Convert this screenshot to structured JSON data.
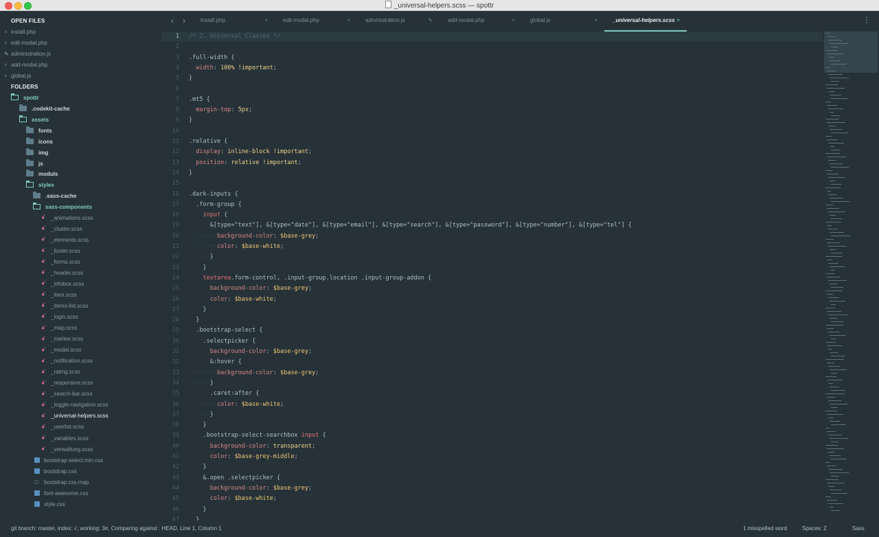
{
  "window": {
    "title": "_universal-helpers.scss — spottr"
  },
  "sidebar": {
    "open_files_header": "OPEN FILES",
    "open_files": [
      {
        "name": "install.php",
        "marker": "×"
      },
      {
        "name": "edit-modal.php",
        "marker": "×"
      },
      {
        "name": "administration.js",
        "marker": "✎"
      },
      {
        "name": "add-modal.php",
        "marker": "×"
      },
      {
        "name": "global.js",
        "marker": "×"
      }
    ],
    "folders_header": "FOLDERS",
    "tree": {
      "root": "spottr",
      "codekit": ".codekit-cache",
      "assets": "assets",
      "fonts": "fonts",
      "icons": "icons",
      "img": "img",
      "js": "js",
      "moduls": "moduls",
      "styles": "styles",
      "sass_cache": ".sass-cache",
      "sass_components": "sass-components",
      "scss_files": [
        "_animations.scss",
        "_cluster.scss",
        "_elements.scss",
        "_footer.scss",
        "_forms.scss",
        "_header.scss",
        "_infobox.scss",
        "_item.scss",
        "_items-list.scss",
        "_login.scss",
        "_map.scss",
        "_marker.scss",
        "_modal.scss",
        "_notification.scss",
        "_rating.scss",
        "_responsive.scss",
        "_search-bar.scss",
        "_toggle-navigation.scss",
        "_universal-helpers.scss",
        "_userlist.scss",
        "_variables.scss",
        "_verwaltung.scss"
      ],
      "css_files": [
        "bootstrap-select.min.css",
        "bootstrap.css",
        "bootstrap.css.map",
        "font-awesome.css",
        "style.css"
      ]
    }
  },
  "tabs": [
    {
      "label": "install.php",
      "close": "×"
    },
    {
      "label": "edit-modal.php",
      "close": "×"
    },
    {
      "label": "administration.js",
      "close": "✎"
    },
    {
      "label": "add-modal.php",
      "close": "×"
    },
    {
      "label": "global.js",
      "close": "×"
    },
    {
      "label": "_universal-helpers.scss",
      "close": "×",
      "active": true
    }
  ],
  "editor": {
    "lines": [
      [
        [
          "c-comment",
          "/* 2. Universal Classes */"
        ]
      ],
      [],
      [
        [
          "c-sel",
          ".full-width {"
        ]
      ],
      [
        [
          "g",
          "  "
        ],
        [
          "c-prop",
          "width"
        ],
        [
          "c-punct",
          ": "
        ],
        [
          "c-val",
          "100% !important"
        ],
        [
          "c-punct",
          ";"
        ]
      ],
      [
        [
          "c-sel",
          "}"
        ]
      ],
      [],
      [
        [
          "c-sel",
          ".mt5 {"
        ]
      ],
      [
        [
          "g",
          "  "
        ],
        [
          "c-prop",
          "margin-top"
        ],
        [
          "c-punct",
          ": "
        ],
        [
          "c-val",
          "5px"
        ],
        [
          "c-punct",
          ";"
        ]
      ],
      [
        [
          "c-sel",
          "}"
        ]
      ],
      [],
      [
        [
          "c-sel",
          ".relative {"
        ]
      ],
      [
        [
          "g",
          "  "
        ],
        [
          "c-prop",
          "display"
        ],
        [
          "c-punct",
          ": "
        ],
        [
          "c-val",
          "inline-block !important"
        ],
        [
          "c-punct",
          ";"
        ]
      ],
      [
        [
          "g",
          "  "
        ],
        [
          "c-prop",
          "position"
        ],
        [
          "c-punct",
          ": "
        ],
        [
          "c-val",
          "relative !important"
        ],
        [
          "c-punct",
          ";"
        ]
      ],
      [
        [
          "c-sel",
          "}"
        ]
      ],
      [],
      [
        [
          "c-sel",
          ".dark-inputs {"
        ]
      ],
      [
        [
          "g",
          "  "
        ],
        [
          "c-sel",
          ".form-group {"
        ]
      ],
      [
        [
          "g",
          "    "
        ],
        [
          "c-tag",
          "input"
        ],
        [
          "c-sel",
          " {"
        ]
      ],
      [
        [
          "g",
          "      "
        ],
        [
          "c-sel",
          "&[type=\"text\"], &[type=\"date\"], &[type=\"email\"], &[type=\"search\"], &[type=\"password\"], &[type=\"number\"], &[type=\"tel\"] {"
        ]
      ],
      [
        [
          "g",
          "········"
        ],
        [
          "c-prop",
          "background-color"
        ],
        [
          "c-punct",
          ": "
        ],
        [
          "c-var",
          "$base-grey"
        ],
        [
          "c-punct",
          ";"
        ]
      ],
      [
        [
          "g",
          "········"
        ],
        [
          "c-prop",
          "color"
        ],
        [
          "c-punct",
          ": "
        ],
        [
          "c-var",
          "$base-white"
        ],
        [
          "c-punct",
          ";"
        ]
      ],
      [
        [
          "g",
          "······"
        ],
        [
          "c-sel",
          "}"
        ]
      ],
      [
        [
          "g",
          "    "
        ],
        [
          "c-sel",
          "}"
        ]
      ],
      [
        [
          "g",
          "    "
        ],
        [
          "c-tag",
          "textarea"
        ],
        [
          "c-sel",
          ".form-control, .input-group.location .input-group-addon {"
        ]
      ],
      [
        [
          "g",
          "      "
        ],
        [
          "c-prop",
          "background-color"
        ],
        [
          "c-punct",
          ": "
        ],
        [
          "c-var",
          "$base-grey"
        ],
        [
          "c-punct",
          ";"
        ]
      ],
      [
        [
          "g",
          "      "
        ],
        [
          "c-prop",
          "color"
        ],
        [
          "c-punct",
          ": "
        ],
        [
          "c-var",
          "$base-white"
        ],
        [
          "c-punct",
          ";"
        ]
      ],
      [
        [
          "g",
          "    "
        ],
        [
          "c-sel",
          "}"
        ]
      ],
      [
        [
          "g",
          "  "
        ],
        [
          "c-sel",
          "}"
        ]
      ],
      [
        [
          "g",
          "  "
        ],
        [
          "c-sel",
          ".bootstrap-select {"
        ]
      ],
      [
        [
          "g",
          "    "
        ],
        [
          "c-sel",
          ".selectpicker {"
        ]
      ],
      [
        [
          "g",
          "      "
        ],
        [
          "c-prop",
          "background-color"
        ],
        [
          "c-punct",
          ": "
        ],
        [
          "c-var",
          "$base-grey"
        ],
        [
          "c-punct",
          ";"
        ]
      ],
      [
        [
          "g",
          "      "
        ],
        [
          "c-sel",
          "&:hover {"
        ]
      ],
      [
        [
          "g",
          "········"
        ],
        [
          "c-prop",
          "background-color"
        ],
        [
          "c-punct",
          ": "
        ],
        [
          "c-var",
          "$base-grey"
        ],
        [
          "c-punct",
          ";"
        ]
      ],
      [
        [
          "g",
          "······"
        ],
        [
          "c-sel",
          "}"
        ]
      ],
      [
        [
          "g",
          "      "
        ],
        [
          "c-sel",
          ".caret:after {"
        ]
      ],
      [
        [
          "g",
          "········"
        ],
        [
          "c-prop",
          "color"
        ],
        [
          "c-punct",
          ": "
        ],
        [
          "c-var",
          "$base-white"
        ],
        [
          "c-punct",
          ";"
        ]
      ],
      [
        [
          "g",
          "······"
        ],
        [
          "c-sel",
          "}"
        ]
      ],
      [
        [
          "g",
          "    "
        ],
        [
          "c-sel",
          "}"
        ]
      ],
      [
        [
          "g",
          "    "
        ],
        [
          "c-sel",
          ".bootstrap-select-searchbox "
        ],
        [
          "c-tag",
          "input"
        ],
        [
          "c-sel",
          " {"
        ]
      ],
      [
        [
          "g",
          "      "
        ],
        [
          "c-prop",
          "background-color"
        ],
        [
          "c-punct",
          ": "
        ],
        [
          "c-val",
          "transparent"
        ],
        [
          "c-punct",
          ";"
        ]
      ],
      [
        [
          "g",
          "      "
        ],
        [
          "c-prop",
          "color"
        ],
        [
          "c-punct",
          ": "
        ],
        [
          "c-var",
          "$base-grey-middle"
        ],
        [
          "c-punct",
          ";"
        ]
      ],
      [
        [
          "g",
          "    "
        ],
        [
          "c-sel",
          "}"
        ]
      ],
      [
        [
          "g",
          "    "
        ],
        [
          "c-sel",
          "&.open .selectpicker {"
        ]
      ],
      [
        [
          "g",
          "      "
        ],
        [
          "c-prop",
          "background-color"
        ],
        [
          "c-punct",
          ": "
        ],
        [
          "c-var",
          "$base-grey"
        ],
        [
          "c-punct",
          ";"
        ]
      ],
      [
        [
          "g",
          "      "
        ],
        [
          "c-prop",
          "color"
        ],
        [
          "c-punct",
          ": "
        ],
        [
          "c-var",
          "$base-white"
        ],
        [
          "c-punct",
          ";"
        ]
      ],
      [
        [
          "g",
          "    "
        ],
        [
          "c-sel",
          "}"
        ]
      ],
      [
        [
          "g",
          "  "
        ],
        [
          "c-sel",
          "}"
        ]
      ]
    ]
  },
  "status": {
    "left": "git branch: master, index: √, working: 3≠, Comparing against : HEAD, Line 1, Column 1",
    "spell": "1 misspelled word",
    "spaces": "Spaces: 2",
    "syntax": "Sass"
  }
}
